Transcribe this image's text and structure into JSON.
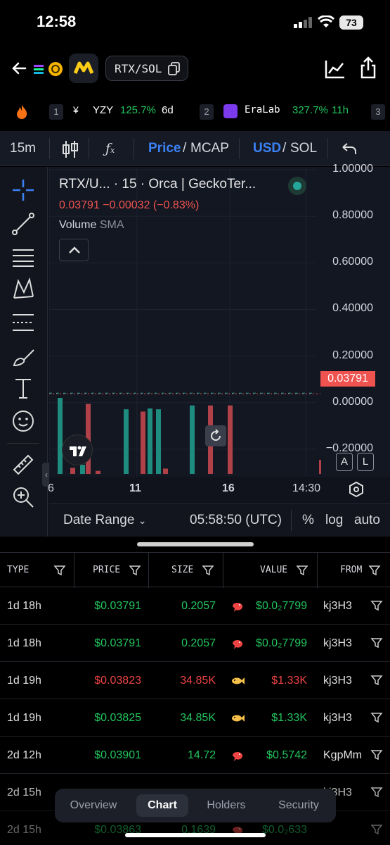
{
  "status": {
    "time": "12:58",
    "battery": "73"
  },
  "header": {
    "pair": "RTX/SOL"
  },
  "ticker": [
    {
      "rank": "",
      "symbol": "",
      "change": "",
      "age": ""
    },
    {
      "rank": "1",
      "symbol": "YZY",
      "change": "125.7%",
      "age": "6d"
    },
    {
      "rank": "2",
      "symbol": "EraLab",
      "change": "327.7%",
      "age": "11h"
    },
    {
      "rank": "3",
      "symbol": "",
      "change": "",
      "age": ""
    }
  ],
  "toolbar": {
    "interval": "15m",
    "price": "Price",
    "slash1": "/",
    "mcap": "MCAP",
    "usd": "USD",
    "slash2": "/",
    "sol": "SOL"
  },
  "chart": {
    "title": "RTX/U... · 15 · Orca | GeckoTer...",
    "price_line": "0.03791 −0.00032 (−0.83%)",
    "volume": "Volume",
    "sma": "SMA",
    "price_tag": "0.03791",
    "y_ticks": [
      "1.00000",
      "0.80000",
      "0.60000",
      "0.40000",
      "0.20000",
      "0.00000",
      "−0.20000"
    ],
    "x_ticks": [
      "6",
      "11",
      "16",
      "14:30"
    ],
    "a_btn": "A",
    "l_btn": "L",
    "date_range": "Date Range",
    "utc": "05:58:50 (UTC)",
    "pct": "%",
    "log": "log",
    "auto": "auto"
  },
  "chart_data": {
    "type": "bar",
    "title": "RTX/U... · 15 · Orca | GeckoTer...",
    "ylim": [
      -0.3,
      1.0
    ],
    "price_level": 0.03791,
    "volume_bars": [
      {
        "dir": "up",
        "h": 1.0
      },
      {
        "dir": "down",
        "h": 0.08
      },
      {
        "dir": "up",
        "h": 0.12
      },
      {
        "dir": "down",
        "h": 0.92
      },
      {
        "dir": "down",
        "h": 0.04
      },
      {
        "dir": "up",
        "h": 0.85
      },
      {
        "dir": "down",
        "h": 0.82
      },
      {
        "dir": "up",
        "h": 0.86
      },
      {
        "dir": "up",
        "h": 0.85
      },
      {
        "dir": "down",
        "h": 0.07
      },
      {
        "dir": "up",
        "h": 0.9
      },
      {
        "dir": "down",
        "h": 0.9
      },
      {
        "dir": "down",
        "h": 0.9
      }
    ]
  },
  "table": {
    "headers": [
      "TYPE",
      "PRICE",
      "SIZE",
      "VALUE",
      "FROM"
    ],
    "rows": [
      {
        "type": "1d 18h",
        "price": "$0.03791",
        "size": "0.2057",
        "value": "$0.0₂7799",
        "from": "kj3H3",
        "side": "buy",
        "icon": "shrimp"
      },
      {
        "type": "1d 18h",
        "price": "$0.03791",
        "size": "0.2057",
        "value": "$0.0₂7799",
        "from": "kj3H3",
        "side": "buy",
        "icon": "shrimp"
      },
      {
        "type": "1d 19h",
        "price": "$0.03823",
        "size": "34.85K",
        "value": "$1.33K",
        "from": "kj3H3",
        "side": "sell",
        "icon": "fish"
      },
      {
        "type": "1d 19h",
        "price": "$0.03825",
        "size": "34.85K",
        "value": "$1.33K",
        "from": "kj3H3",
        "side": "buy",
        "icon": "fish"
      },
      {
        "type": "2d 12h",
        "price": "$0.03901",
        "size": "14.72",
        "value": "$0.5742",
        "from": "KgpMm",
        "side": "buy",
        "icon": "shrimp"
      },
      {
        "type": "2d 15h",
        "price": "",
        "size": "",
        "value": "",
        "from": "kj3H3",
        "side": "buy",
        "icon": "shrimp"
      },
      {
        "type": "2d 15h",
        "price": "$0.03863",
        "size": "0.1639",
        "value": "$0.0₂633",
        "from": "",
        "side": "buy",
        "icon": "shrimp"
      }
    ]
  },
  "tabs": [
    "Overview",
    "Chart",
    "Holders",
    "Security"
  ],
  "colors": {
    "buy": "#22c55e",
    "sell": "#ef4444",
    "accent": "#3b82f6"
  }
}
